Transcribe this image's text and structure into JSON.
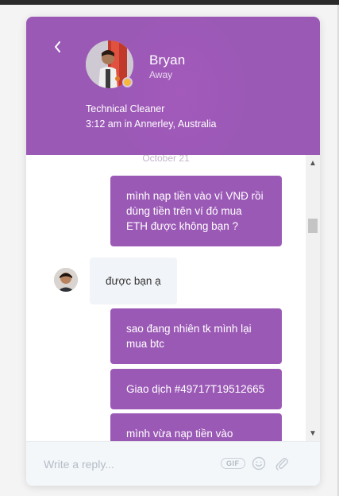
{
  "header": {
    "name": "Bryan",
    "status": "Away",
    "job_title": "Technical Cleaner",
    "local_info": "3:12 am in Annerley, Australia",
    "colors": {
      "accent": "#9b59b6",
      "status_away": "#f5b83d"
    }
  },
  "conversation": {
    "date_separator": "October 21",
    "messages": [
      {
        "direction": "outgoing",
        "text": "mình nạp tiền vào ví VNĐ rồi dùng tiền trên ví đó mua ETH được không bạn ?"
      },
      {
        "direction": "incoming",
        "text": "được bạn ạ"
      },
      {
        "direction": "outgoing",
        "text": "sao đang nhiên tk mình lại mua btc"
      },
      {
        "direction": "outgoing",
        "text": "Giao dịch #49717T19512665"
      },
      {
        "direction": "outgoing",
        "text": "mình vừa nạp tiền vào"
      }
    ]
  },
  "composer": {
    "placeholder": "Write a reply...",
    "gif_label": "GIF",
    "icons": [
      "emoji-icon",
      "paperclip-icon"
    ]
  },
  "scrollbar": {
    "up_icon": "▲",
    "down_icon": "▼"
  }
}
